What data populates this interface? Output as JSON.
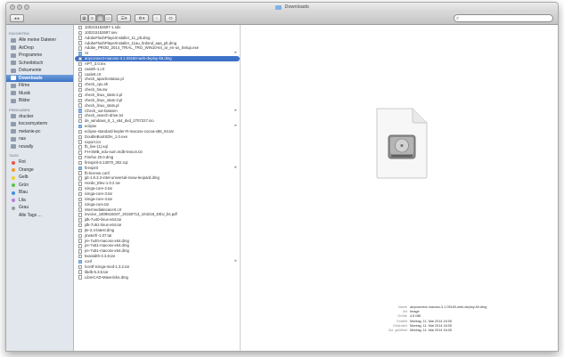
{
  "window": {
    "title": "Downloads",
    "search_placeholder": ""
  },
  "sidebar": {
    "favorites_label": "FAVORITEN",
    "favorites": [
      {
        "label": "Alle meine Dateien",
        "icon": "all-files-icon"
      },
      {
        "label": "AirDrop",
        "icon": "airdrop-icon"
      },
      {
        "label": "Programme",
        "icon": "applications-icon"
      },
      {
        "label": "Schreibtisch",
        "icon": "desktop-icon"
      },
      {
        "label": "Dokumente",
        "icon": "documents-icon"
      },
      {
        "label": "Downloads",
        "icon": "downloads-icon",
        "selected": true
      },
      {
        "label": "Filme",
        "icon": "movies-icon"
      },
      {
        "label": "Musik",
        "icon": "music-icon"
      },
      {
        "label": "Bilder",
        "icon": "pictures-icon"
      }
    ],
    "shared_label": "FREIGABEN",
    "shared": [
      {
        "label": "drucker",
        "icon": "server-icon"
      },
      {
        "label": "kocosmysterm",
        "icon": "server-icon"
      },
      {
        "label": "melanie-pc",
        "icon": "server-icon"
      },
      {
        "label": "nas",
        "icon": "server-icon"
      },
      {
        "label": "ncwally",
        "icon": "server-icon"
      }
    ],
    "tags_label": "TAGS",
    "tags": [
      {
        "label": "Rot",
        "color": "#e8534a"
      },
      {
        "label": "Orange",
        "color": "#f39a2b"
      },
      {
        "label": "Gelb",
        "color": "#efcf2f"
      },
      {
        "label": "Grün",
        "color": "#5cc44a"
      },
      {
        "label": "Blau",
        "color": "#3f8fe6"
      },
      {
        "label": "Lila",
        "color": "#b57fd9"
      },
      {
        "label": "Grau",
        "color": "#9a9a9a"
      },
      {
        "label": "Alle Tags ...",
        "color": ""
      }
    ]
  },
  "files": [
    {
      "name": "100215152697-1.sdx",
      "kind": "file"
    },
    {
      "name": "100215152697.sev",
      "kind": "file"
    },
    {
      "name": "AdobeFlashPlayerInstaller_11_plt.dmg",
      "kind": "file"
    },
    {
      "name": "AdobeFlashPlayerInstaller_11au_ltrdsnd_aaa_plt.dmg",
      "kind": "file"
    },
    {
      "name": "Adobe_PROD_2014_TRIAL_TRG_WIN10-64_ar_en-us_Setup.exe",
      "kind": "file"
    },
    {
      "name": "AI",
      "kind": "folder"
    },
    {
      "name": "anyconnect-macosx-3.1.05160-web-deploy-k9.dmg",
      "kind": "file",
      "selected": true
    },
    {
      "name": "APT_3.0.tex",
      "kind": "file"
    },
    {
      "name": "casleh-1.crt",
      "kind": "file"
    },
    {
      "name": "caslett.crt",
      "kind": "file"
    },
    {
      "name": "check_apachestatus.pl",
      "kind": "file"
    },
    {
      "name": "check_cpu.sh",
      "kind": "file"
    },
    {
      "name": "check_hw.sw",
      "kind": "file"
    },
    {
      "name": "check_linux_stats-2.pl",
      "kind": "file"
    },
    {
      "name": "check_linux_stats-3.pl",
      "kind": "file"
    },
    {
      "name": "check_linux_stats.pl",
      "kind": "file"
    },
    {
      "name": "Check_out-Dateien",
      "kind": "folder"
    },
    {
      "name": "check_search-drive.txt",
      "kind": "file"
    },
    {
      "name": "de_windows_8_1_x64_dvd_2707227.iso",
      "kind": "file"
    },
    {
      "name": "eclipse",
      "kind": "folder"
    },
    {
      "name": "eclipse-standard-kepler-R-macosx-cocoa-x86_64.tar",
      "kind": "file"
    },
    {
      "name": "DoubleBootSDH_1.0.exe",
      "kind": "file"
    },
    {
      "name": "export.ics",
      "kind": "file"
    },
    {
      "name": "fb_live-(1).sql",
      "kind": "file"
    },
    {
      "name": "FH-SMB_edu-sum.mdb-lesson.txt",
      "kind": "file"
    },
    {
      "name": "Firefox 20.0.dmg",
      "kind": "file"
    },
    {
      "name": "firespirit-5.13070_302.rqz",
      "kind": "file"
    },
    {
      "name": "firespirit",
      "kind": "folder"
    },
    {
      "name": "fb-license.conf",
      "kind": "file"
    },
    {
      "name": "git-1.8.3.2-intel-universal-snow-leopard.dmg",
      "kind": "file"
    },
    {
      "name": "Horde_Elev-1.0.2.rar",
      "kind": "file"
    },
    {
      "name": "icinga-core-2.tar",
      "kind": "file"
    },
    {
      "name": "icinga-core-3.tar",
      "kind": "file"
    },
    {
      "name": "icinga-core-4.tar",
      "kind": "file"
    },
    {
      "name": "icinga-core.tar",
      "kind": "file"
    },
    {
      "name": "intermediatecacert.crt",
      "kind": "file"
    },
    {
      "name": "invoice_180961504T_20150713_104218_DEU_bs.pdf",
      "kind": "file"
    },
    {
      "name": "jdk-7u40-linux-x64.tar",
      "kind": "file"
    },
    {
      "name": "jdk-7u51-linux-x64.tar",
      "kind": "file"
    },
    {
      "name": "jte-2.4-latest.dmg",
      "kind": "file"
    },
    {
      "name": "jmeterfr-1.07.tar",
      "kind": "file"
    },
    {
      "name": "jre-7u40-macosx-x64.dmg",
      "kind": "file"
    },
    {
      "name": "jre-7u51-macosx-x64.dmg",
      "kind": "file"
    },
    {
      "name": "jre-7u51-macosx-x64.dmg",
      "kind": "file"
    },
    {
      "name": "kvanalith-4.3.8.tar",
      "kind": "file"
    },
    {
      "name": "conf",
      "kind": "folder"
    },
    {
      "name": "lcontf-Icinga-mod-1.3.2.tar",
      "kind": "file"
    },
    {
      "name": "libdb-5.3.5.tar",
      "kind": "file"
    },
    {
      "name": "LibreCAD-Mavericks.dmg",
      "kind": "file"
    }
  ],
  "preview": {
    "icon": "disk-image-icon",
    "info": [
      {
        "label": "Name",
        "value": "anyconnect-macosx-3.1.05160-web-deploy-k9.dmg"
      },
      {
        "label": "Art",
        "value": "Image"
      },
      {
        "label": "Größe",
        "value": "4,5 MB"
      },
      {
        "label": "Erstellt",
        "value": "Montag, 11. Mai 2014 16:05"
      },
      {
        "label": "Geändert",
        "value": "Montag, 11. Mai 2014 16:05"
      },
      {
        "label": "Zul. geöffnet",
        "value": "Montag, 11. Mai 2014 16:05"
      }
    ]
  }
}
